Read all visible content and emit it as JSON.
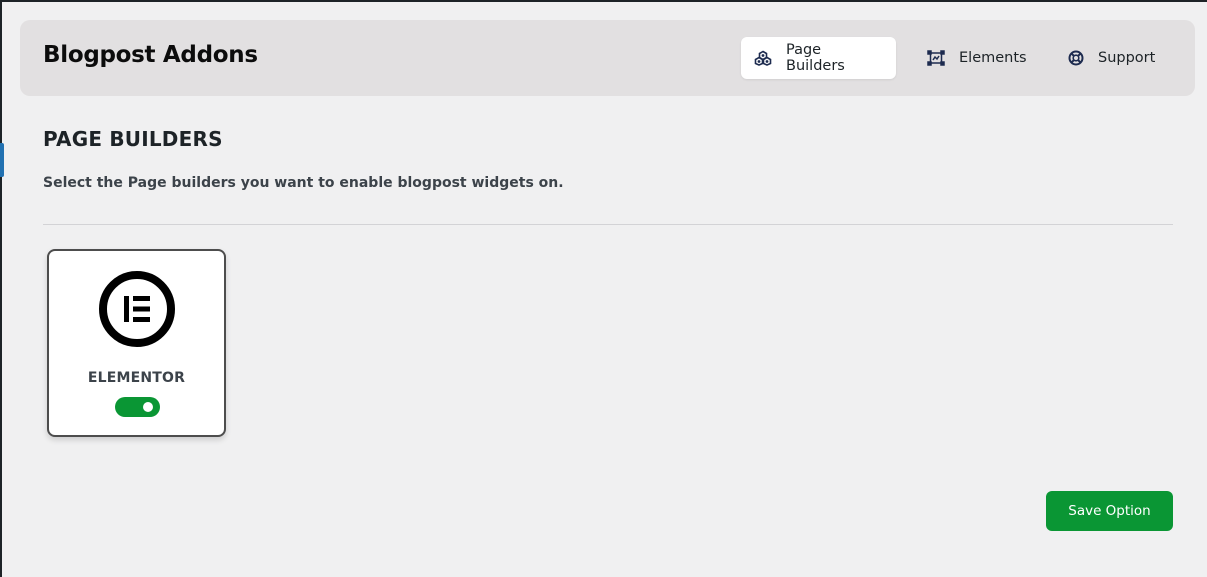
{
  "header": {
    "brand": "Blogpost Addons",
    "nav": [
      {
        "label": "Page Builders",
        "icon": "cubes-icon",
        "active": true
      },
      {
        "label": "Elements",
        "icon": "frame-icon",
        "active": false
      },
      {
        "label": "Support",
        "icon": "lifebuoy-icon",
        "active": false
      }
    ]
  },
  "section": {
    "title": "PAGE BUILDERS",
    "description": "Select the Page builders you want to enable blogpost widgets on."
  },
  "builders": [
    {
      "name": "ELEMENTOR",
      "icon": "elementor-logo-icon",
      "enabled": true
    }
  ],
  "actions": {
    "save_label": "Save Option"
  },
  "colors": {
    "accent_green": "#0a9634",
    "header_bg": "#e2e0e1",
    "page_bg": "#f0f0f1"
  }
}
